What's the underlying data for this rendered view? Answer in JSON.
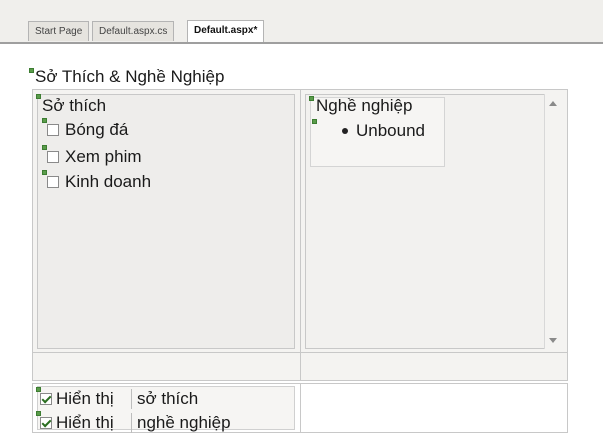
{
  "tabs": [
    {
      "label": "Start Page"
    },
    {
      "label": "Default.aspx.cs"
    },
    {
      "label": "Default.aspx*"
    }
  ],
  "section": {
    "title": "Sở Thích & Nghề Nghiệp"
  },
  "hobbies": {
    "title": "Sở thích",
    "items": [
      {
        "label": "Bóng đá"
      },
      {
        "label": "Xem phim"
      },
      {
        "label": "Kinh doanh"
      }
    ]
  },
  "careers": {
    "title": "Nghề nghiệp",
    "items": [
      {
        "label": "Unbound"
      }
    ]
  },
  "toggles": [
    {
      "label_prefix": "Hiển thị",
      "label_rest": "sở thích",
      "checked": true
    },
    {
      "label_prefix": "Hiển thị",
      "label_rest": "nghề nghiệp",
      "checked": true
    }
  ],
  "colors": {
    "marker": "#5a9c4a",
    "tab_active": "#ffffff"
  }
}
